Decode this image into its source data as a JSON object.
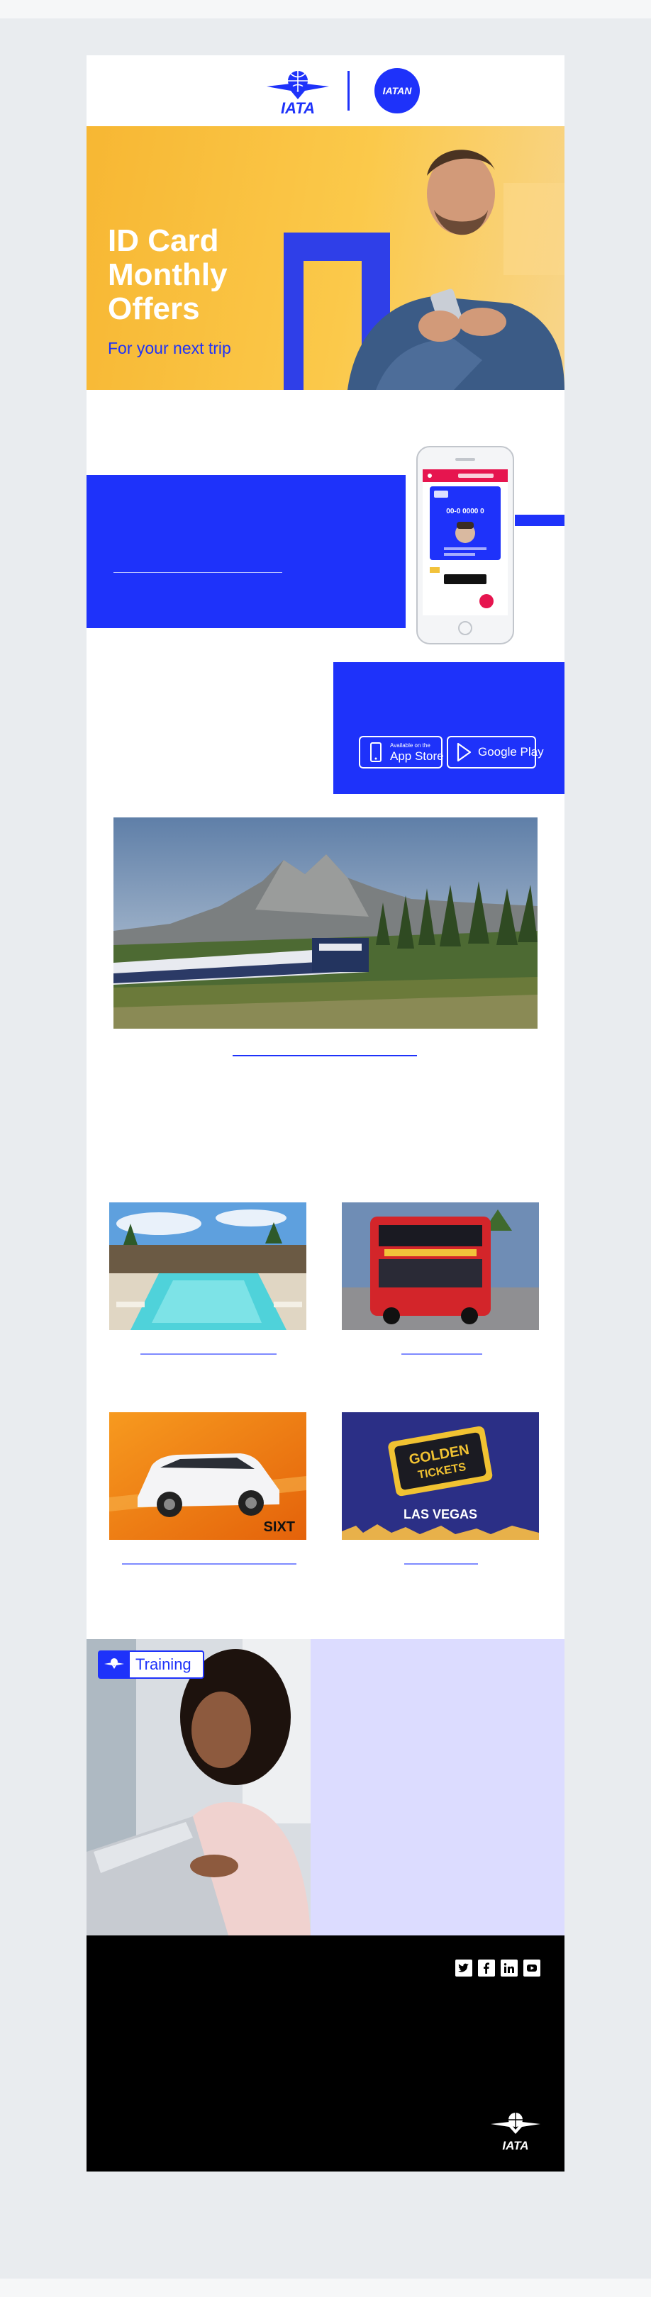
{
  "header": {
    "logo_iata_text": "IATA",
    "logo_iatan_text": "IATAN"
  },
  "hero": {
    "title_lines": [
      "ID Card",
      "Monthly",
      "Offers"
    ],
    "subtitle": "For your next trip"
  },
  "app": {
    "phone_id_number": "00-0 0000 0",
    "store_buttons": {
      "apple_small": "Available on the",
      "apple_big": "App Store",
      "google": "Google Play"
    }
  },
  "offers": {
    "sixt_logo": "SIXT",
    "golden_tickets": [
      "GOLDEN",
      "TICKETS"
    ],
    "las_vegas": "LAS VEGAS"
  },
  "training": {
    "badge": "Training"
  },
  "footer": {
    "logo_text": "IATA",
    "social_icons": [
      "twitter-icon",
      "facebook-icon",
      "linkedin-icon",
      "youtube-icon"
    ]
  },
  "colors": {
    "brand_blue": "#1e32fa",
    "hero_yellow": "#f7b733",
    "training_bg": "#dcdcff",
    "footer_bg": "#000000"
  }
}
